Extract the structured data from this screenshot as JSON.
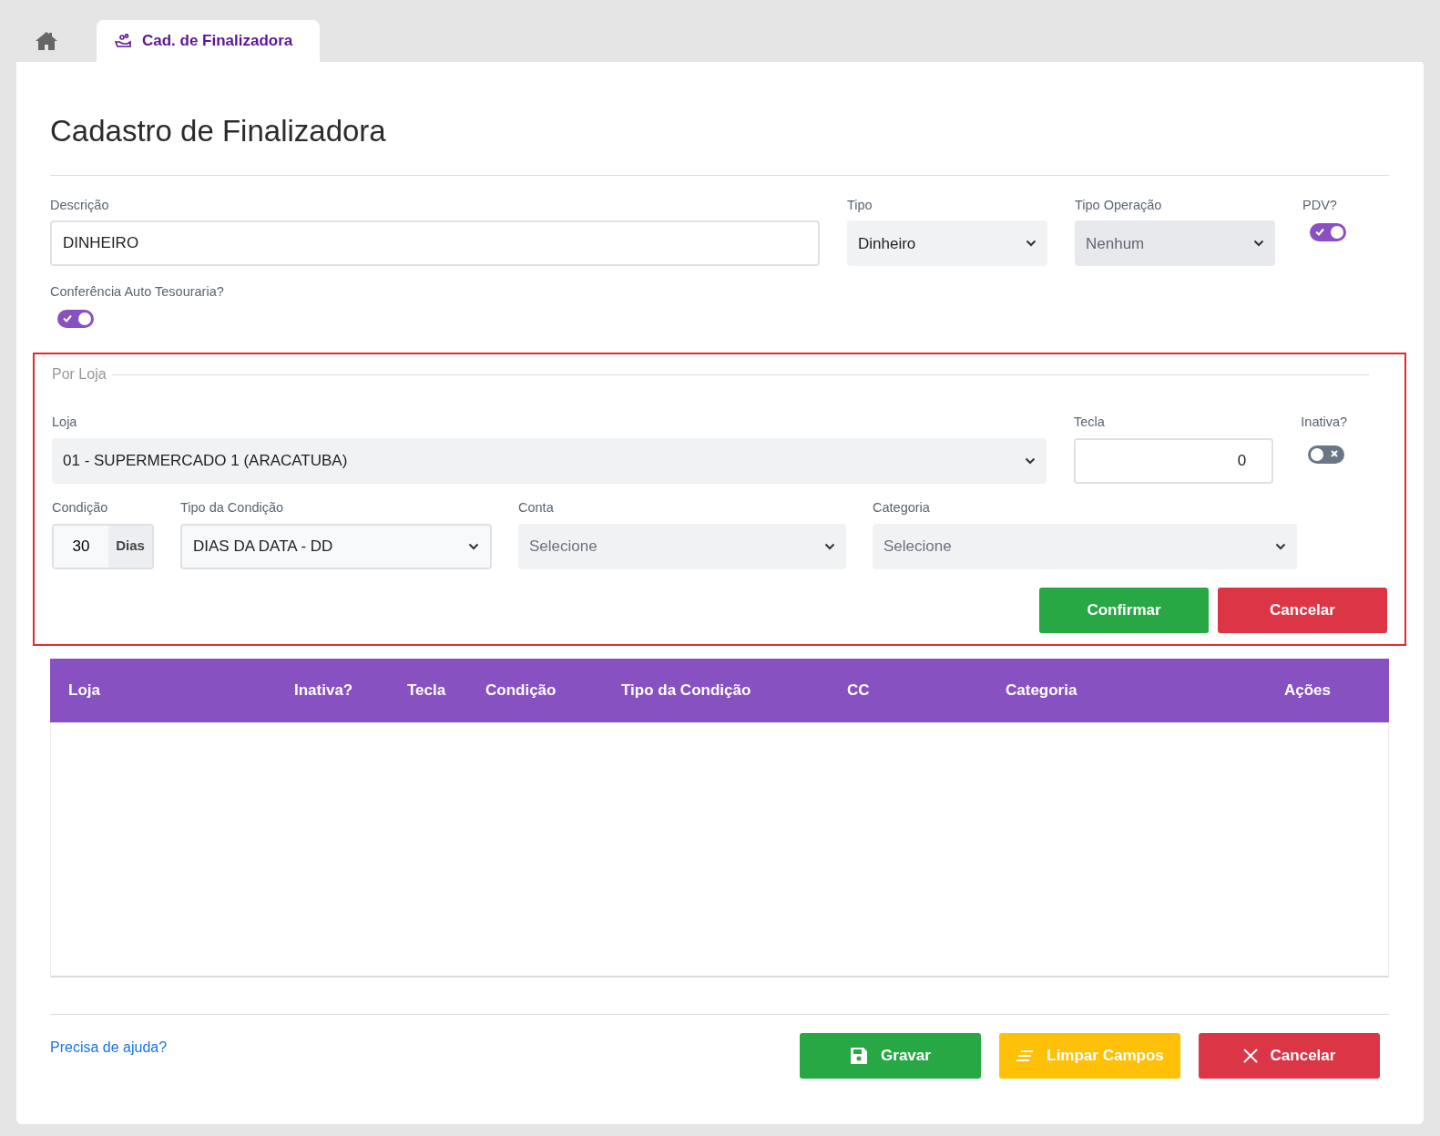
{
  "tabs": [
    {
      "kind": "home",
      "selected": false
    },
    {
      "kind": "page",
      "label": "Cad. de Finalizadora",
      "selected": true
    }
  ],
  "title": "Cadastro de Finalizadora",
  "main_fields": [
    {
      "kind": "text",
      "label": "Descrição",
      "value": "DINHEIRO"
    },
    {
      "kind": "select",
      "label": "Tipo",
      "value": "Dinheiro",
      "disabled": false
    },
    {
      "kind": "select",
      "label": "Tipo Operação",
      "value": "Nenhum",
      "disabled": true
    },
    {
      "kind": "switch",
      "label": "PDV?",
      "on": true
    }
  ],
  "conferencia": {
    "label": "Conferência Auto Tesouraria?",
    "on": true
  },
  "por_loja": {
    "legend": "Por Loja",
    "loja": {
      "label": "Loja",
      "value": "01 - SUPERMERCADO 1 (ARACATUBA)"
    },
    "tecla": {
      "label": "Tecla",
      "value": "0"
    },
    "inativa": {
      "label": "Inativa?",
      "on": false
    },
    "condicao": {
      "label": "Condição",
      "value": "30",
      "suffix": "Dias"
    },
    "selects": [
      {
        "label": "Tipo da Condição",
        "value": "DIAS DA DATA - DD",
        "bordered": true
      },
      {
        "label": "Conta",
        "placeholder": "Selecione",
        "bordered": false
      },
      {
        "label": "Categoria",
        "placeholder": "Selecione",
        "bordered": false
      }
    ],
    "buttons": [
      {
        "kind": "confirm",
        "label": "Confirmar"
      },
      {
        "kind": "cancel",
        "label": "Cancelar"
      }
    ]
  },
  "table": {
    "columns": [
      "Loja",
      "Inativa?",
      "Tecla",
      "Condição",
      "Tipo da Condição",
      "CC",
      "Categoria",
      "Ações"
    ]
  },
  "help_link": "Precisa de ajuda?",
  "footer_buttons": [
    {
      "kind": "save",
      "label": "Gravar"
    },
    {
      "kind": "clear",
      "label": "Limpar Campos"
    },
    {
      "kind": "cancel",
      "label": "Cancelar"
    }
  ]
}
